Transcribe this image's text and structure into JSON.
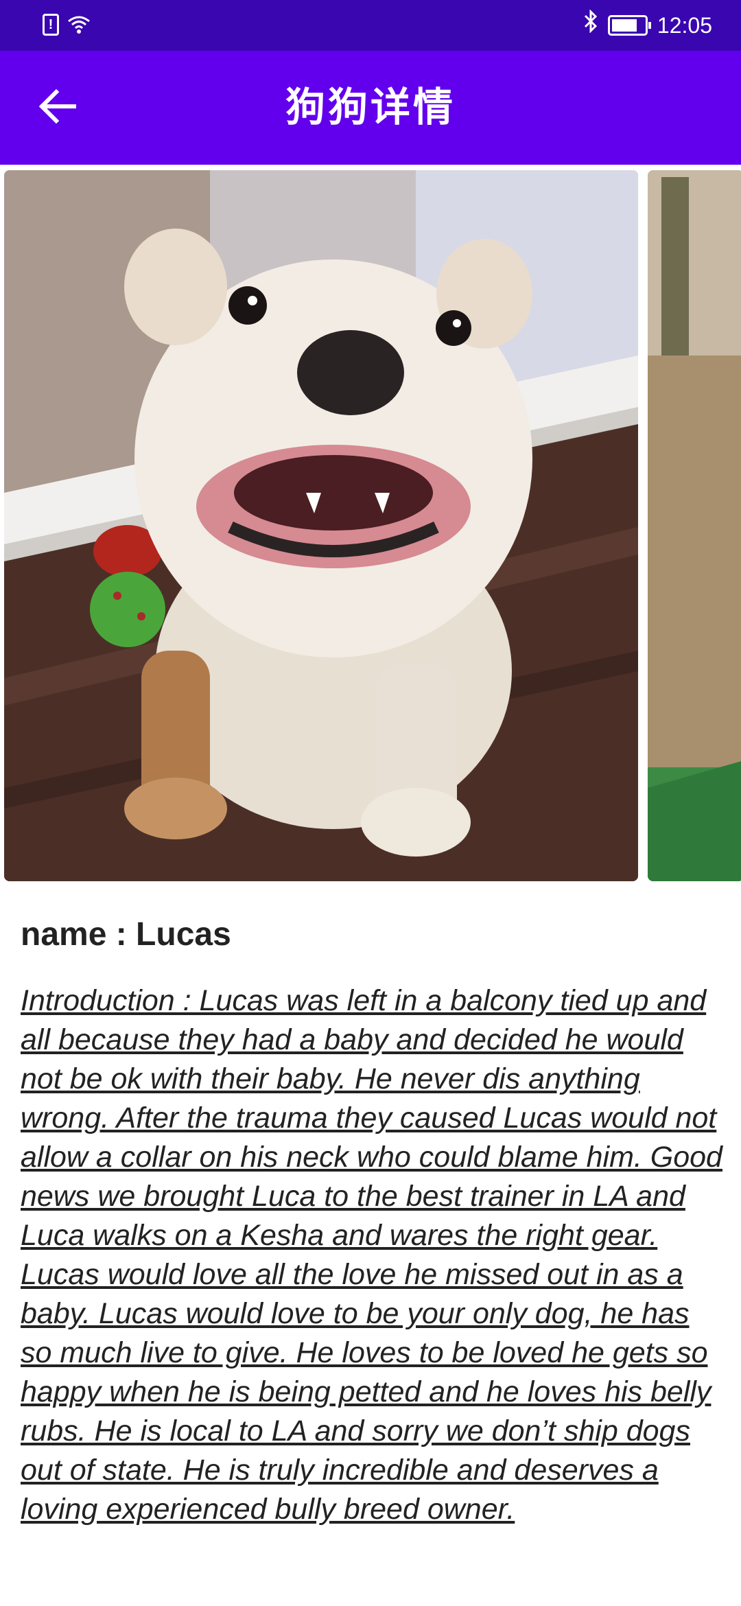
{
  "status_bar": {
    "time": "12:05",
    "icons": [
      "sim-alert-icon",
      "wifi-icon",
      "bluetooth-icon",
      "battery-icon"
    ]
  },
  "app_bar": {
    "title": "狗狗详情",
    "back_icon": "arrow-left-icon"
  },
  "colors": {
    "status_bar": "#3a06b0",
    "app_bar": "#6200ee",
    "text": "#222222"
  },
  "dog": {
    "name_line": "name : Lucas",
    "introduction": "Introduction : Lucas was left in a balcony tied up and all because they had a baby and decided he would not be ok with their baby. He never dis anything wrong. After the trauma they caused Lucas would not allow a collar on his neck who could blame him. Good news we brought Luca to the best trainer in LA and Luca walks on a Kesha and wares the right gear. Lucas would love all the love he missed out in as a baby. Lucas would love to be your only dog, he has so much live to give. He loves to be loved he gets so happy when he is being petted and he loves his belly rubs. He is local to LA and sorry we don’t ship dogs out of state. He is truly incredible and deserves a loving experienced bully breed owner."
  },
  "carousel": {
    "images": [
      "bulldog-photo",
      "next-dog-photo"
    ]
  }
}
